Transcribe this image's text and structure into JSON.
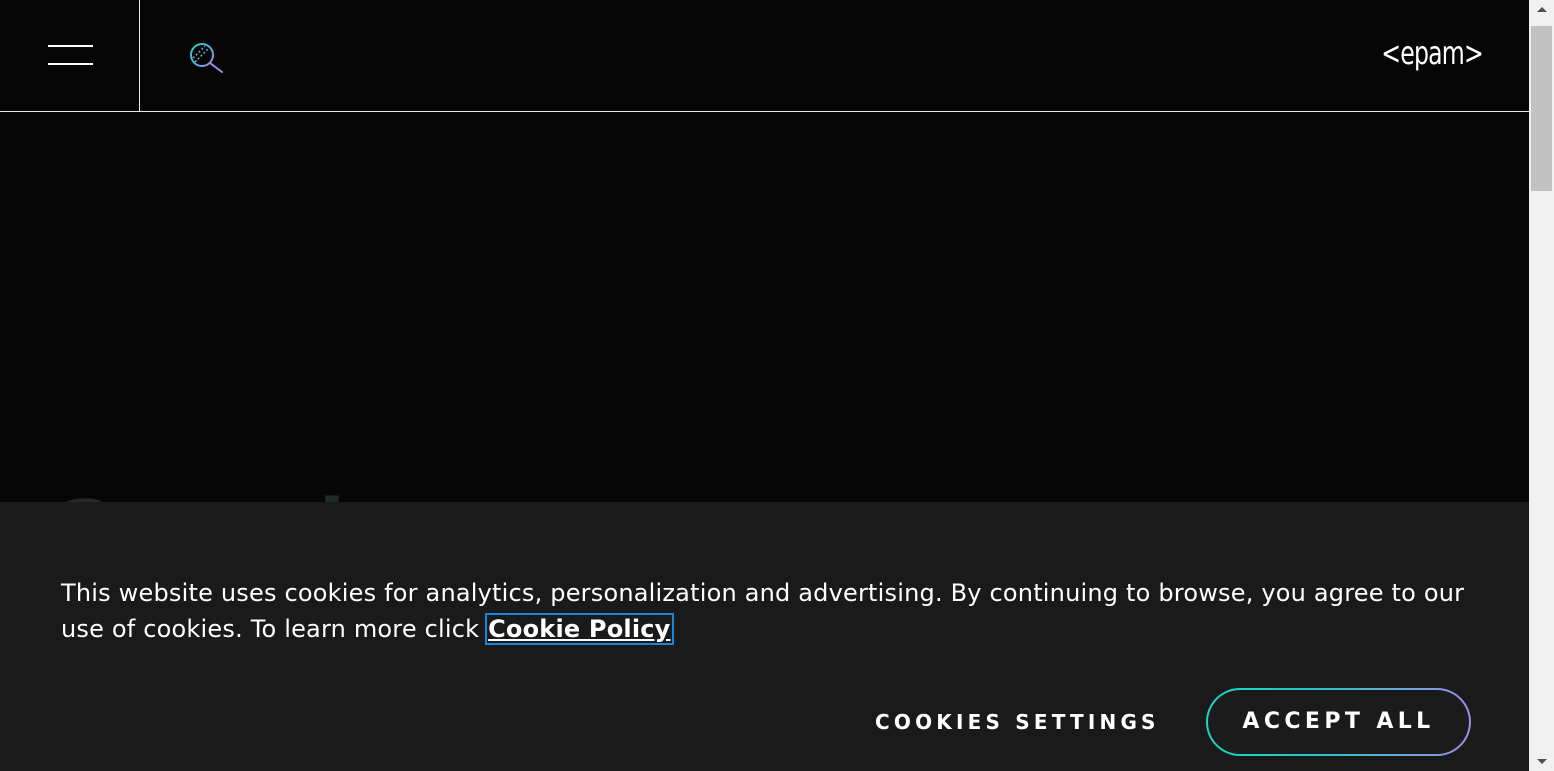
{
  "header": {
    "logo_text": "<epam>",
    "menu_icon": "hamburger-icon",
    "search_icon": "search-icon"
  },
  "hero": {
    "title": "Search"
  },
  "cookie_banner": {
    "message": "This website uses cookies for analytics, personalization and advertising. By continuing to browse, you agree to our use of cookies. To learn more click ",
    "link_label": "Cookie Policy",
    "settings_label": "COOKIES SETTINGS",
    "accept_label": "ACCEPT ALL"
  },
  "colors": {
    "background": "#060606",
    "banner": "#1b1b1b",
    "accent_start": "#18d6c2",
    "accent_end": "#9b8de6",
    "focus_outline": "#1a86d9"
  }
}
